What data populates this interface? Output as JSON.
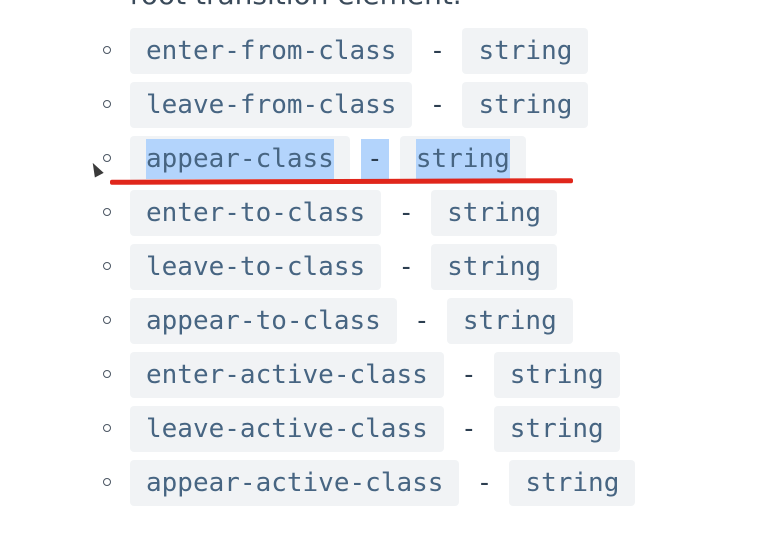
{
  "header_fragment": "root transition element.",
  "items": [
    {
      "name": "enter-from-class",
      "separator": "-",
      "type": "string"
    },
    {
      "name": "leave-from-class",
      "separator": "-",
      "type": "string"
    },
    {
      "name": "appear-class",
      "separator": "-",
      "type": "string",
      "selected": true
    },
    {
      "name": "enter-to-class",
      "separator": "-",
      "type": "string"
    },
    {
      "name": "leave-to-class",
      "separator": "-",
      "type": "string"
    },
    {
      "name": "appear-to-class",
      "separator": "-",
      "type": "string"
    },
    {
      "name": "enter-active-class",
      "separator": "-",
      "type": "string"
    },
    {
      "name": "leave-active-class",
      "separator": "-",
      "type": "string"
    },
    {
      "name": "appear-active-class",
      "separator": "-",
      "type": "string"
    }
  ],
  "colors": {
    "code_background": "#f1f3f5",
    "code_text": "#476582",
    "selection": "#b3d4fc",
    "annotation_underline": "#e0261b"
  },
  "icons": {
    "bullet": "hollow-circle-bullet-icon",
    "cursor": "mouse-pointer-icon"
  }
}
